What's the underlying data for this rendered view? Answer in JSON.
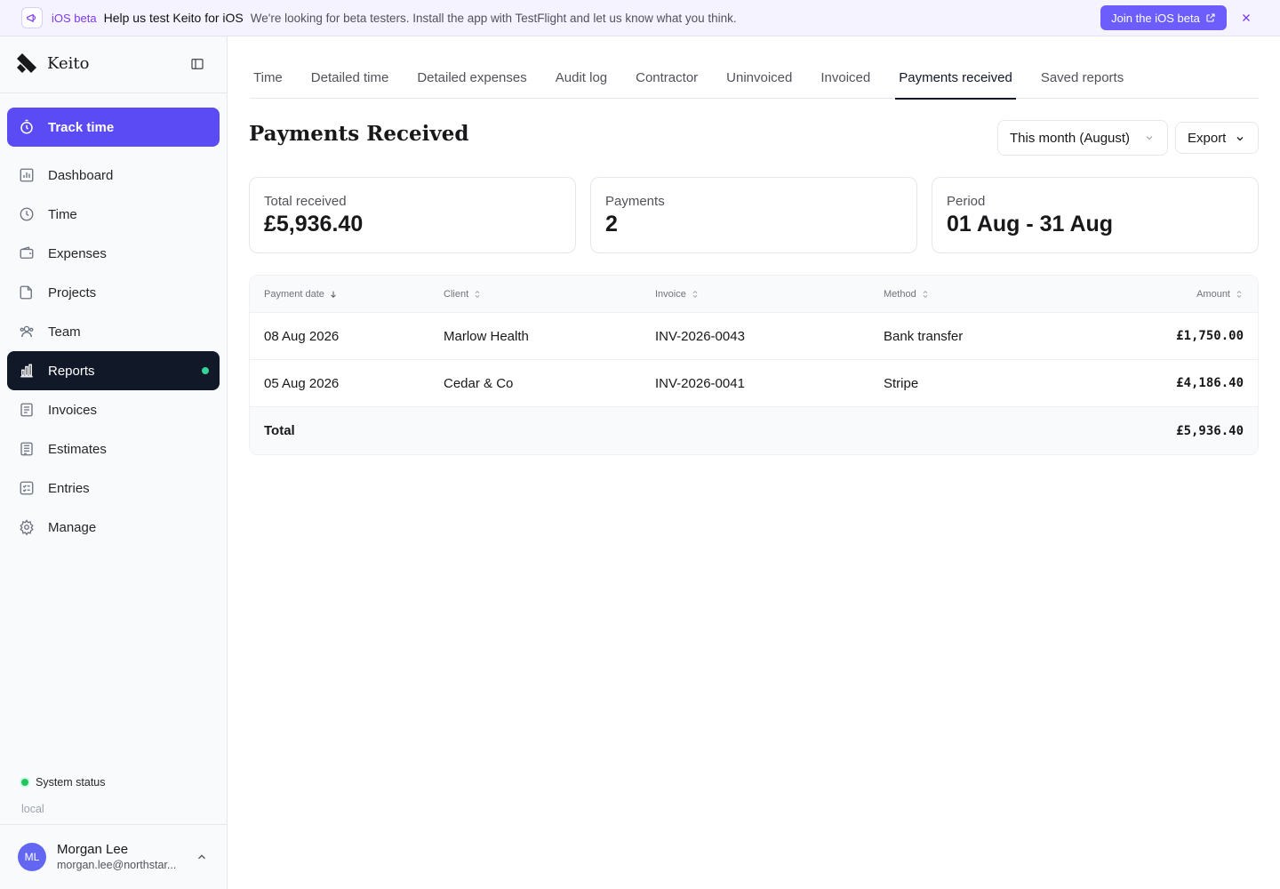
{
  "banner": {
    "tag": "iOS beta",
    "title": "Help us test Keito for iOS",
    "text": "We're looking for beta testers. Install the app with TestFlight and let us know what you think.",
    "cta": "Join the iOS beta"
  },
  "sidebar": {
    "brand": "Keito",
    "track_label": "Track time",
    "items": [
      {
        "label": "Dashboard",
        "icon": "dashboard-icon"
      },
      {
        "label": "Time",
        "icon": "clock-icon"
      },
      {
        "label": "Expenses",
        "icon": "wallet-icon"
      },
      {
        "label": "Projects",
        "icon": "folder-icon"
      },
      {
        "label": "Team",
        "icon": "users-icon"
      },
      {
        "label": "Reports",
        "icon": "bar-chart-icon",
        "active": true
      },
      {
        "label": "Invoices",
        "icon": "invoice-icon"
      },
      {
        "label": "Estimates",
        "icon": "estimate-icon"
      },
      {
        "label": "Entries",
        "icon": "checklist-icon"
      },
      {
        "label": "Manage",
        "icon": "gear-icon"
      }
    ],
    "status": "System status",
    "env": "local",
    "user": {
      "initials": "ML",
      "name": "Morgan Lee",
      "email": "morgan.lee@northstar..."
    }
  },
  "tabs": [
    {
      "label": "Time"
    },
    {
      "label": "Detailed time"
    },
    {
      "label": "Detailed expenses"
    },
    {
      "label": "Audit log"
    },
    {
      "label": "Contractor"
    },
    {
      "label": "Uninvoiced"
    },
    {
      "label": "Invoiced"
    },
    {
      "label": "Payments received",
      "active": true
    },
    {
      "label": "Saved reports"
    }
  ],
  "page": {
    "title": "Payments Received",
    "period": "This month (August)",
    "export": "Export"
  },
  "cards": {
    "total_label": "Total received",
    "total_value": "£5,936.40",
    "payments_label": "Payments",
    "payments_value": "2",
    "period_label": "Period",
    "period_value": "01 Aug - 31 Aug"
  },
  "table": {
    "headers": {
      "date": "Payment date",
      "client": "Client",
      "invoice": "Invoice",
      "method": "Method",
      "amount": "Amount"
    },
    "rows": [
      {
        "date": "08 Aug 2026",
        "client": "Marlow Health",
        "invoice": "INV-2026-0043",
        "method": "Bank transfer",
        "amount": "£1,750.00"
      },
      {
        "date": "05 Aug 2026",
        "client": "Cedar & Co",
        "invoice": "INV-2026-0041",
        "method": "Stripe",
        "amount": "£4,186.40"
      }
    ],
    "total_label": "Total",
    "total_amount": "£5,936.40"
  }
}
